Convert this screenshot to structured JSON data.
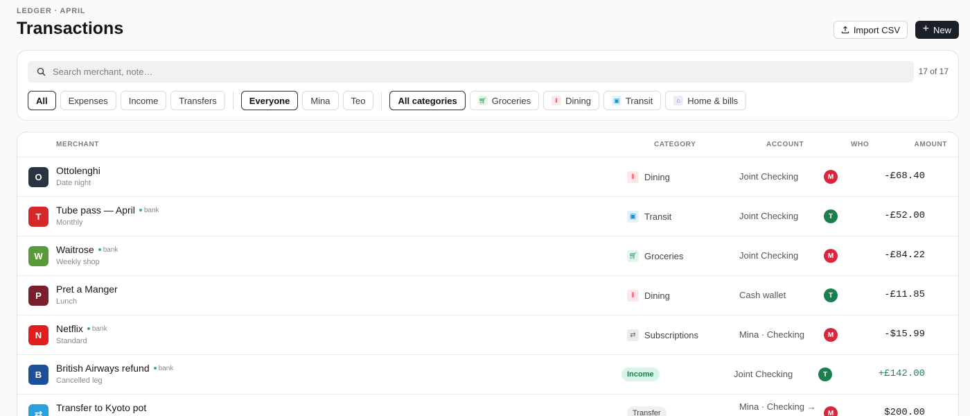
{
  "header": {
    "eyebrow": "LEDGER · APRIL",
    "title": "Transactions",
    "import_label": "Import CSV",
    "new_label": "New"
  },
  "search": {
    "placeholder": "Search merchant, note…",
    "count": "17 of 17"
  },
  "filters": {
    "type": [
      "All",
      "Expenses",
      "Income",
      "Transfers"
    ],
    "people": [
      "Everyone",
      "Mina",
      "Teo"
    ],
    "categories_all": "All categories",
    "categories": [
      {
        "label": "Groceries",
        "icon": "cart-icon"
      },
      {
        "label": "Dining",
        "icon": "fork-knife-icon"
      },
      {
        "label": "Transit",
        "icon": "train-icon"
      },
      {
        "label": "Home & bills",
        "icon": "house-icon"
      }
    ]
  },
  "table": {
    "columns": {
      "merchant": "MERCHANT",
      "category": "CATEGORY",
      "account": "ACCOUNT",
      "who": "WHO",
      "amount": "AMOUNT"
    },
    "rows": [
      {
        "initial": "O",
        "avatar_color": "#2b3240",
        "merchant": "Ottolenghi",
        "bank": "",
        "note": "Date night",
        "category": "Dining",
        "account": "Joint Checking",
        "who": "M",
        "who_color": "#d7263d",
        "amount": "-£68.40"
      },
      {
        "initial": "T",
        "avatar_color": "#d62828",
        "merchant": "Tube pass — April",
        "bank": "bank",
        "note": "Monthly",
        "category": "Transit",
        "account": "Joint Checking",
        "who": "T",
        "who_color": "#1a7f4d",
        "amount": "-£52.00"
      },
      {
        "initial": "W",
        "avatar_color": "#5a9a3a",
        "merchant": "Waitrose",
        "bank": "bank",
        "note": "Weekly shop",
        "category": "Groceries",
        "account": "Joint Checking",
        "who": "M",
        "who_color": "#d7263d",
        "amount": "-£84.22"
      },
      {
        "initial": "P",
        "avatar_color": "#7a1e2b",
        "merchant": "Pret a Manger",
        "bank": "",
        "note": "Lunch",
        "category": "Dining",
        "account": "Cash wallet",
        "who": "T",
        "who_color": "#1a7f4d",
        "amount": "-£11.85"
      },
      {
        "initial": "N",
        "avatar_color": "#e01e1e",
        "merchant": "Netflix",
        "bank": "bank",
        "note": "Standard",
        "category": "Subscriptions",
        "account": "Mina · Checking",
        "who": "M",
        "who_color": "#d7263d",
        "amount": "-$15.99"
      },
      {
        "initial": "B",
        "avatar_color": "#1d4f9a",
        "merchant": "British Airways refund",
        "bank": "bank",
        "note": "Cancelled leg",
        "category": "Income",
        "account": "Joint Checking",
        "who": "T",
        "who_color": "#1a7f4d",
        "amount": "+£142.00"
      },
      {
        "initial": "⇄",
        "avatar_color": "#2aa0e0",
        "merchant": "Transfer to Kyoto pot",
        "bank": "",
        "note": "",
        "category": "Transfer",
        "account": "Mina · Checking →",
        "who": "M",
        "who_color": "#d7263d",
        "amount": "$200.00"
      }
    ]
  }
}
